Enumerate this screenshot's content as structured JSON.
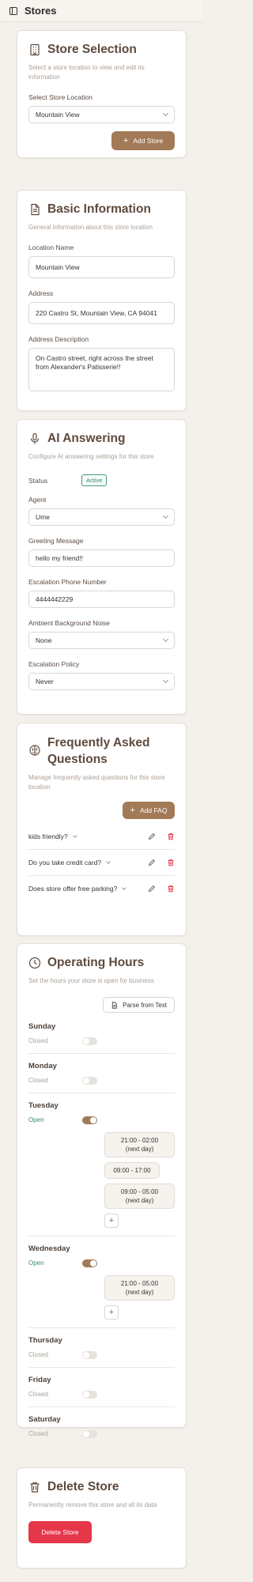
{
  "header": {
    "title": "Stores"
  },
  "store_selection": {
    "title": "Store Selection",
    "desc": "Select a store location to view and edit its information",
    "select_label": "Select Store Location",
    "selected": "Mountain View",
    "add_label": "Add Store"
  },
  "basic": {
    "title": "Basic Information",
    "desc": "General information about this store location",
    "name_label": "Location Name",
    "name_value": "Mountain View",
    "address_label": "Address",
    "address_value": "220 Castro St, Mountain View, CA 94041",
    "desc_label": "Address Description",
    "desc_value": "On Castro street, right across the street from Alexander's Patisserie!!"
  },
  "ai": {
    "title": "AI Answering",
    "desc": "Configure AI answering settings for this store",
    "status_label": "Status",
    "status_value": "Active",
    "agent_label": "Agent",
    "agent_value": "Ume",
    "greeting_label": "Greeting Message",
    "greeting_value": "hello my friend!!",
    "phone_label": "Escalation Phone Number",
    "phone_value": "4444442229",
    "noise_label": "Ambient Background Noise",
    "noise_value": "None",
    "policy_label": "Escalation Policy",
    "policy_value": "Never"
  },
  "faq": {
    "title": "Frequently Asked Questions",
    "desc": "Manage frequently asked questions for this store location",
    "add_label": "Add FAQ",
    "items": [
      {
        "q": "kids friendly?"
      },
      {
        "q": "Do you take credit card?"
      },
      {
        "q": "Does store offer free parking?"
      }
    ]
  },
  "hours": {
    "title": "Operating Hours",
    "desc": "Set the hours your store is open for business",
    "parse_label": "Parse from Text",
    "closed": "Closed",
    "open": "Open",
    "days": [
      {
        "name": "Sunday",
        "open": false,
        "slots": []
      },
      {
        "name": "Monday",
        "open": false,
        "slots": []
      },
      {
        "name": "Tuesday",
        "open": true,
        "slots": [
          "21:00 - 02:00\n(next day)",
          "09:00 - 17:00",
          "09:00 - 05:00\n(next day)"
        ]
      },
      {
        "name": "Wednesday",
        "open": true,
        "slots": [
          "21:00 - 05:00\n(next day)"
        ]
      },
      {
        "name": "Thursday",
        "open": false,
        "slots": []
      },
      {
        "name": "Friday",
        "open": false,
        "slots": []
      },
      {
        "name": "Saturday",
        "open": false,
        "slots": []
      }
    ]
  },
  "delete": {
    "title": "Delete Store",
    "desc": "Permanently remove this store and all its data",
    "button": "Delete Store"
  },
  "colors": {
    "accent": "#a27a57",
    "title": "#5e4a3d",
    "danger": "#e5364a",
    "success": "#3b8b67"
  }
}
